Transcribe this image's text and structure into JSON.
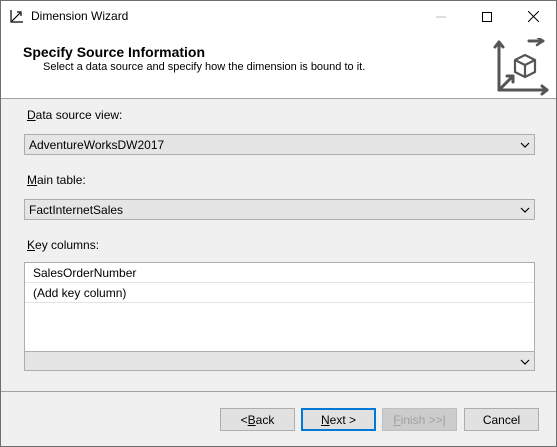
{
  "window": {
    "title": "Dimension Wizard"
  },
  "header": {
    "title": "Specify Source Information",
    "subtitle": "Select a data source and specify how the dimension is bound to it."
  },
  "data_source_view": {
    "label_accel": "D",
    "label_rest": "ata source view:",
    "value": "AdventureWorksDW2017"
  },
  "main_table": {
    "label_accel": "M",
    "label_rest": "ain table:",
    "value": "FactInternetSales"
  },
  "key_columns": {
    "label_accel": "K",
    "label_rest": "ey columns:",
    "rows": [
      "SalesOrderNumber",
      "(Add key column)"
    ]
  },
  "name_column": {
    "value": ""
  },
  "buttons": {
    "back_pre": "< ",
    "back_accel": "B",
    "back_rest": "ack",
    "next_accel": "N",
    "next_rest": "ext >",
    "finish_accel": "F",
    "finish_rest": "inish >>|",
    "cancel": "Cancel"
  },
  "colors": {
    "window_bg": "#f0f0f0",
    "header_bg": "#ffffff",
    "combo_bg": "#e5e5e5",
    "default_button_border": "#0078d7",
    "disabled_text": "#a0a0a0"
  }
}
